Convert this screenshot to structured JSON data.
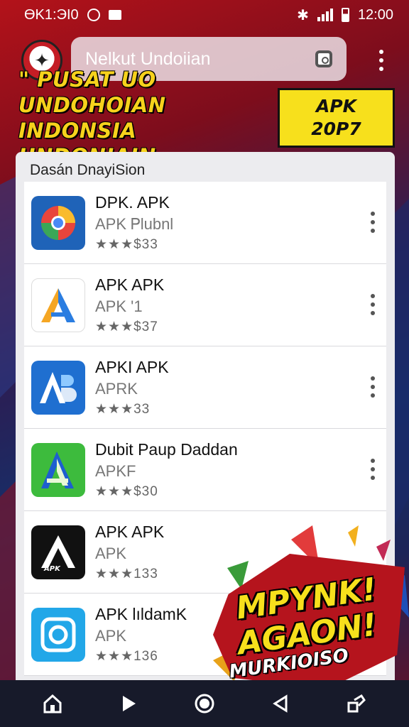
{
  "status_bar": {
    "left_text": "ӨK1:ЭI0",
    "time": "12:00"
  },
  "header": {
    "search_placeholder": "Nelkut Undoiian",
    "logo_icon": "brand-logo-icon",
    "lens_icon": "camera-lens-icon",
    "menu_icon": "more-vertical-icon"
  },
  "banner": {
    "line1": "\" PUSAT UO UNDOHOIAN",
    "line2": "INDONSIA UNDONIAIN",
    "badge_line1": "APK",
    "badge_line2": "20P7"
  },
  "section": {
    "title": "Dasán DnayiSion"
  },
  "apps": [
    {
      "name": "DPK. APK",
      "sub": "APK Ꮲlubnl",
      "rating": "★★★$33",
      "icon": "chrome-like-icon",
      "icon_bg": "#1f63b8"
    },
    {
      "name": "APK APK",
      "sub": "APK  '1",
      "rating": "★★★$37",
      "icon": "a-triangle-icon",
      "icon_bg": "#ffffff"
    },
    {
      "name": "APKI APK",
      "sub": "APRK",
      "rating": "★★★33",
      "icon": "ab-letter-icon",
      "icon_bg": "#1f6fd0"
    },
    {
      "name": "Dubit Paup Daddan",
      "sub": "APKF",
      "rating": "★★★$30",
      "icon": "green-a-icon",
      "icon_bg": "#3dbb3d"
    },
    {
      "name": "APK APK",
      "sub": "APK",
      "rating": "★★★133",
      "icon": "black-a-icon",
      "icon_bg": "#111111"
    },
    {
      "name": "APK lıldamK",
      "sub": "APK",
      "rating": "★★★136",
      "icon": "camera-app-icon",
      "icon_bg": "#22a7e8"
    }
  ],
  "promo": {
    "line1": "MPYNK!",
    "line2": "AGAON!",
    "line3": "MURKIOISO"
  },
  "nav_bar": {
    "home_icon": "home-icon",
    "play_icon": "play-icon",
    "circle_icon": "circle-home-icon",
    "back_icon": "back-icon",
    "recent_icon": "recent-apps-icon"
  },
  "colors": {
    "banner_yellow": "#f7d21c",
    "brand_red": "#b5141d",
    "panel_bg": "#ececef"
  }
}
